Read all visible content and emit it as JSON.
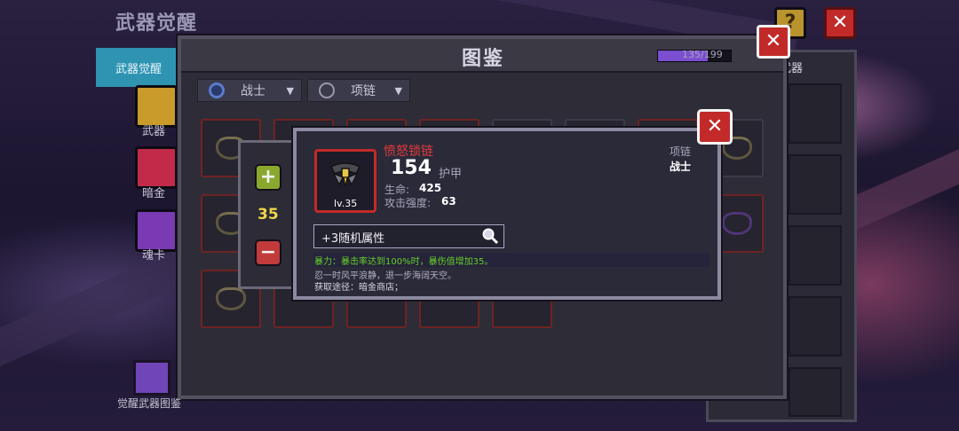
{
  "header": {
    "title": "武器觉醒"
  },
  "sidebar": {
    "active_tab": "武器觉醒",
    "items": [
      {
        "label": "武器"
      },
      {
        "label": "暗金"
      },
      {
        "label": "魂卡"
      }
    ],
    "bottom_label": "觉醒武器图鉴"
  },
  "back_panel": {
    "title": "武器"
  },
  "codex": {
    "title": "图鉴",
    "progress_text": "135/199",
    "progress_fraction": 0.678,
    "filters": [
      {
        "label": "战士",
        "icon": "shield-icon"
      },
      {
        "label": "项链",
        "icon": "necklace-icon"
      }
    ]
  },
  "stepper": {
    "quantity": "35",
    "plus": "+",
    "minus": "−"
  },
  "item": {
    "name": "愤怒锁链",
    "level": "lv.35",
    "armor_value": "154",
    "armor_label": "护甲",
    "stats": [
      {
        "label": "生命:",
        "value": "425"
      },
      {
        "label": "攻击强度:",
        "value": "63"
      }
    ],
    "type": "项链",
    "class": "战士",
    "random_attr": "+3随机属性",
    "effect": "暴力：暴击率达到100%时，暴伤值增加35。",
    "flavor": "忍一时风平浪静，退一步海阔天空。",
    "source": "获取途径：暗金商店；"
  },
  "colors": {
    "accent_red": "#c22a2a",
    "name_red": "#e23c3c",
    "effect_green": "#66d12a",
    "qty_yellow": "#f0d64a"
  }
}
